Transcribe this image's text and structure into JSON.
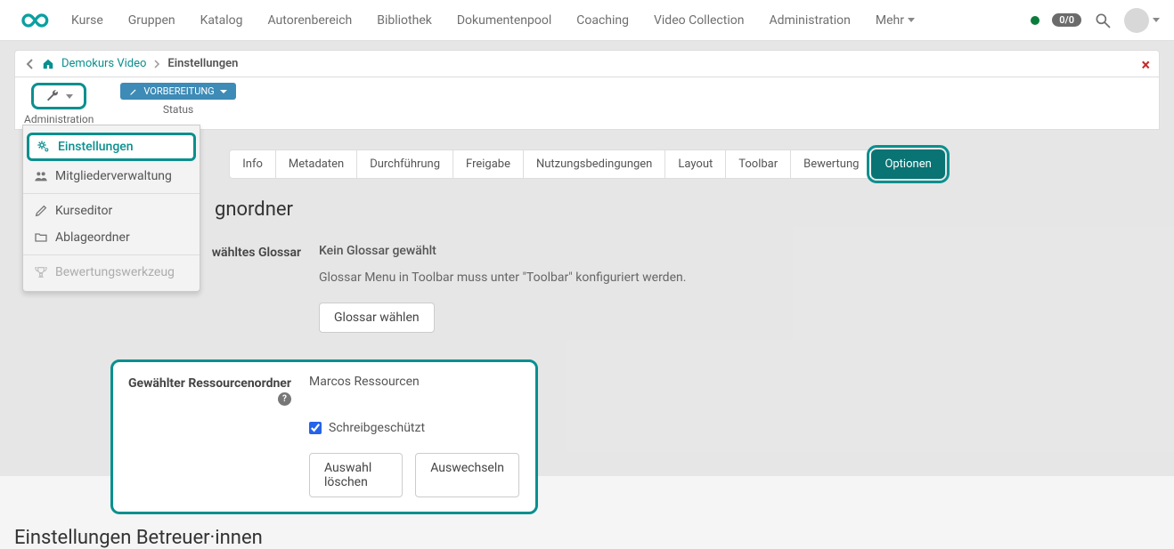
{
  "nav": {
    "items": [
      "Kurse",
      "Gruppen",
      "Katalog",
      "Autorenbereich",
      "Bibliothek",
      "Dokumentenpool",
      "Coaching",
      "Video Collection",
      "Administration",
      "Mehr"
    ],
    "badge": "0/0"
  },
  "breadcrumb": {
    "course": "Demokurs Video",
    "current": "Einstellungen"
  },
  "toolbar": {
    "admin_label": "Administration",
    "status_label": "Status",
    "status_value": "VORBEREITUNG"
  },
  "dropdown": {
    "items": [
      {
        "icon": "gears",
        "label": "Einstellungen",
        "selected": true
      },
      {
        "icon": "users",
        "label": "Mitgliederverwaltung",
        "selected": false
      },
      {
        "icon": "edit",
        "label": "Kurseditor",
        "selected": false
      },
      {
        "icon": "folder",
        "label": "Ablageordner",
        "selected": false
      },
      {
        "icon": "trophy",
        "label": "Bewertungswerkzeug",
        "selected": false
      }
    ]
  },
  "tabs": [
    "Info",
    "Metadaten",
    "Durchführung",
    "Freigabe",
    "Nutzungsbedingungen",
    "Layout",
    "Toolbar",
    "Bewertung",
    "Optionen"
  ],
  "active_tab": "Optionen",
  "section1": {
    "title_suffix": "gnordner",
    "glossar_label": "wähltes Glossar",
    "glossar_value": "Kein Glossar gewählt",
    "glossar_note": "Glossar Menu in Toolbar muss unter \"Toolbar\" konfiguriert werden.",
    "glossar_btn": "Glossar wählen"
  },
  "resource": {
    "label": "Gewählter Ressourcenordner",
    "value": "Marcos Ressourcen",
    "readonly_label": "Schreibgeschützt",
    "btn_clear": "Auswahl löschen",
    "btn_swap": "Auswechseln"
  },
  "section2_title": "Einstellungen Betreuer·innen"
}
